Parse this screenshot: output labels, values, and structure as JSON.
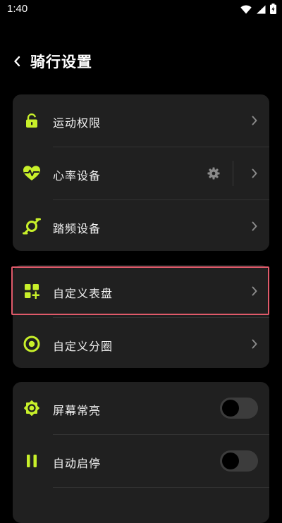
{
  "status_bar": {
    "time": "1:40"
  },
  "header": {
    "title": "骑行设置"
  },
  "colors": {
    "accent": "#c8f02a",
    "card_bg": "#202020",
    "chevron": "#8a8a8a",
    "highlight": "#e05a6a"
  },
  "settings": {
    "exercise_permission": {
      "label": "运动权限",
      "icon": "lock-icon"
    },
    "heart_rate_device": {
      "label": "心率设备",
      "icon": "heart-rate-icon"
    },
    "cadence_device": {
      "label": "踏频设备",
      "icon": "cadence-icon"
    },
    "custom_dial": {
      "label": "自定义表盘",
      "icon": "dashboard-grid-icon"
    },
    "custom_lap": {
      "label": "自定义分圈",
      "icon": "target-ring-icon"
    },
    "screen_always_on": {
      "label": "屏幕常亮",
      "icon": "sun-icon",
      "enabled": false
    },
    "auto_pause": {
      "label": "自动启停",
      "icon": "pause-icon",
      "enabled": false
    }
  }
}
